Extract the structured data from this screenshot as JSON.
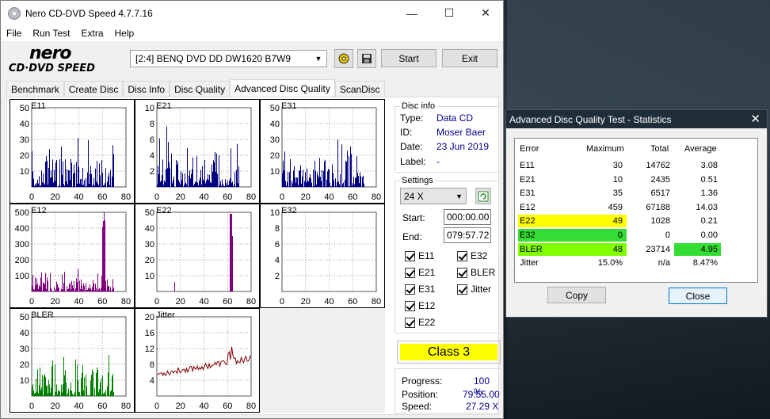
{
  "main_window": {
    "title": "Nero CD-DVD Speed 4.7.7.16",
    "buttons": {
      "minimize": "—",
      "maximize": "☐",
      "close": "✕"
    },
    "menu": [
      "File",
      "Run Test",
      "Extra",
      "Help"
    ],
    "logo": {
      "line1": "nero",
      "line2": "CD·DVD SPEED"
    },
    "drive": "[2:4]   BENQ DVD DD DW1620 B7W9",
    "start_label": "Start",
    "exit_label": "Exit",
    "tabs": [
      "Benchmark",
      "Create Disc",
      "Disc Info",
      "Disc Quality",
      "Advanced Disc Quality",
      "ScanDisc"
    ],
    "active_tab": "Advanced Disc Quality"
  },
  "charts": [
    {
      "name": "E11",
      "yticks": [
        "50",
        "40",
        "30",
        "20",
        "10"
      ],
      "ymax": 50,
      "color": "#000080"
    },
    {
      "name": "E21",
      "yticks": [
        "10",
        "8",
        "6",
        "4",
        "2"
      ],
      "ymax": 10,
      "color": "#000080"
    },
    {
      "name": "E31",
      "yticks": [
        "50",
        "40",
        "30",
        "20",
        "10"
      ],
      "ymax": 50,
      "color": "#000080"
    },
    {
      "name": "E12",
      "yticks": [
        "500",
        "400",
        "300",
        "200",
        "100"
      ],
      "ymax": 500,
      "color": "#800080"
    },
    {
      "name": "E22",
      "yticks": [
        "50",
        "40",
        "30",
        "20",
        "10"
      ],
      "ymax": 50,
      "color": "#800080"
    },
    {
      "name": "E32",
      "yticks": [
        "10",
        "8",
        "6",
        "4",
        "2"
      ],
      "ymax": 10,
      "color": "#800080"
    },
    {
      "name": "BLER",
      "yticks": [
        "50",
        "40",
        "30",
        "20",
        "10"
      ],
      "ymax": 50,
      "color": "#008000"
    },
    {
      "name": "Jitter",
      "yticks": [
        "20",
        "16",
        "12",
        "8",
        "4"
      ],
      "ymax": 20,
      "color": "#800000"
    }
  ],
  "xticks": [
    "0",
    "20",
    "40",
    "60",
    "80"
  ],
  "disc_info": {
    "legend": "Disc info",
    "type_label": "Type:",
    "type": "Data CD",
    "id_label": "ID:",
    "id": "Moser Baer",
    "date_label": "Date:",
    "date": "23 Jun 2019",
    "label_label": "Label:",
    "label": "-"
  },
  "settings": {
    "legend": "Settings",
    "speed": "24 X",
    "start_label": "Start:",
    "start": "000:00.00",
    "end_label": "End:",
    "end": "079:57.72",
    "checks_left": [
      "E11",
      "E21",
      "E31",
      "E12",
      "E22"
    ],
    "checks_right": [
      "E32",
      "BLER",
      "Jitter"
    ]
  },
  "class_label": "Class 3",
  "progress": {
    "progress_label": "Progress:",
    "progress": "100 %",
    "position_label": "Position:",
    "position": "79:55.00",
    "speed_label": "Speed:",
    "speed": "27.29 X"
  },
  "stats_dialog": {
    "title": "Advanced Disc Quality Test - Statistics",
    "headers": [
      "Error",
      "Maximum",
      "Total",
      "Average"
    ],
    "rows": [
      {
        "error": "E11",
        "maximum": "30",
        "total": "14762",
        "average": "3.08"
      },
      {
        "error": "E21",
        "maximum": "10",
        "total": "2435",
        "average": "0.51"
      },
      {
        "error": "E31",
        "maximum": "35",
        "total": "6517",
        "average": "1.36"
      },
      {
        "error": "E12",
        "maximum": "459",
        "total": "67188",
        "average": "14.03"
      },
      {
        "error": "E22",
        "maximum": "49",
        "total": "1028",
        "average": "0.21"
      },
      {
        "error": "E32",
        "maximum": "0",
        "total": "0",
        "average": "0.00"
      },
      {
        "error": "BLER",
        "maximum": "48",
        "total": "23714",
        "average": "4.95"
      },
      {
        "error": "Jitter",
        "maximum": "15.0%",
        "total": "n/a",
        "average": "8.47%"
      }
    ],
    "copy_label": "Copy",
    "close_label": "Close",
    "highlight_colors": {
      "yellow": "#ffff00",
      "green": "#33dd33",
      "lime": "#80ff00"
    }
  }
}
